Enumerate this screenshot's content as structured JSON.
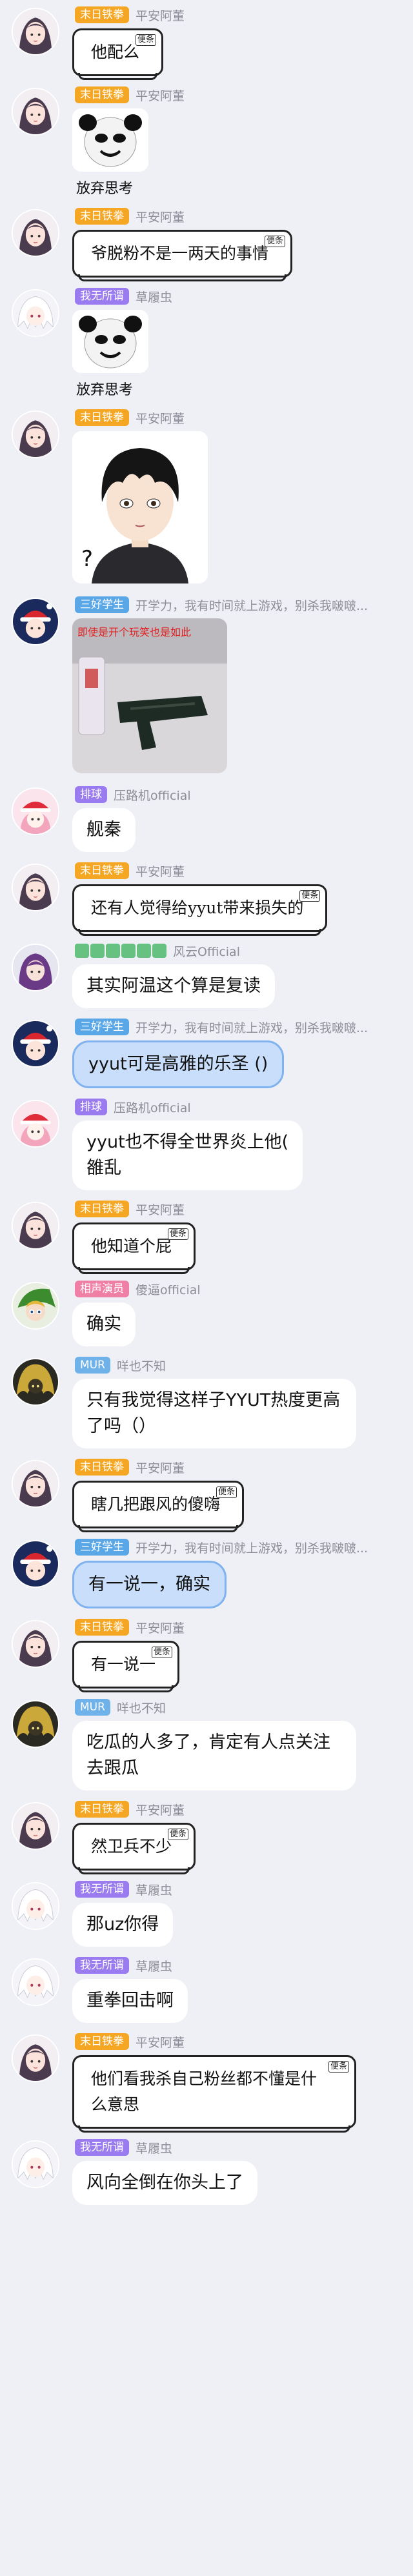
{
  "colors": {
    "badge_orange": "#f5a623",
    "badge_purple": "#9b7cf0",
    "badge_blue": "#5aa7e8",
    "badge_lightblue": "#6fb1e9",
    "badge_pink": "#f07fa6"
  },
  "messages": [
    {
      "badge": "末日铁拳",
      "badge_color": "#f5a623",
      "name": "平安阿董",
      "avatar": "girl-avatar",
      "type": "scroll",
      "text": "他配么",
      "tag": "便条"
    },
    {
      "badge": "末日铁拳",
      "badge_color": "#f5a623",
      "name": "平安阿董",
      "avatar": "girl-avatar",
      "type": "sticker",
      "caption": "放弃思考",
      "sticker": "panda-face-sticker"
    },
    {
      "badge": "末日铁拳",
      "badge_color": "#f5a623",
      "name": "平安阿董",
      "avatar": "girl-avatar",
      "type": "scroll",
      "text": "爷脱粉不是一两天的事情",
      "tag": "便条"
    },
    {
      "badge": "我无所谓",
      "badge_color": "#9b7cf0",
      "name": "草履虫",
      "avatar": "white-hair-avatar",
      "type": "sticker",
      "caption": "放弃思考",
      "sticker": "panda-face-sticker"
    },
    {
      "badge": "末日铁拳",
      "badge_color": "#f5a623",
      "name": "平安阿董",
      "avatar": "girl-avatar",
      "type": "anime",
      "question": "?"
    },
    {
      "badge": "三好学生",
      "badge_color": "#5aa7e8",
      "name": "开学力，我有时间就上游戏，别杀我啵啵...",
      "avatar": "santa-avatar",
      "type": "photo",
      "overlay": "即使是开个玩笑也是如此"
    },
    {
      "badge": "排球",
      "badge_color": "#9b7cf0",
      "name": "压路机official",
      "avatar": "pink-avatar",
      "type": "text",
      "text": "舰秦"
    },
    {
      "badge": "末日铁拳",
      "badge_color": "#f5a623",
      "name": "平安阿董",
      "avatar": "girl-avatar",
      "type": "scroll",
      "text": "还有人觉得给yyut带来损失的",
      "tag": "便条"
    },
    {
      "badge": "",
      "badge_color": "#67c281",
      "name": "风云Official",
      "avatar": "purple-avatar",
      "type": "text",
      "text": "其实阿温这个算是复读",
      "group_badge": true
    },
    {
      "badge": "三好学生",
      "badge_color": "#5aa7e8",
      "name": "开学力，我有时间就上游戏，别杀我啵啵...",
      "avatar": "santa-avatar",
      "type": "cloud",
      "text": "yyut可是高雅的乐圣 ()"
    },
    {
      "badge": "排球",
      "badge_color": "#9b7cf0",
      "name": "压路机official",
      "avatar": "pink-avatar",
      "type": "text",
      "text": "yyut也不得全世界炎上他(\n雒乱"
    },
    {
      "badge": "末日铁拳",
      "badge_color": "#f5a623",
      "name": "平安阿董",
      "avatar": "girl-avatar",
      "type": "scroll",
      "text": "他知道个屁",
      "tag": "便条"
    },
    {
      "badge": "相声演员",
      "badge_color": "#f07fa6",
      "name": "傻逼official",
      "avatar": "link-avatar",
      "type": "text",
      "text": "确实"
    },
    {
      "badge": "MUR",
      "badge_color": "#6fb1e9",
      "name": "咩也不知",
      "avatar": "dark-avatar",
      "type": "text",
      "text": "只有我觉得这样子YYUT热度更高了吗（）"
    },
    {
      "badge": "末日铁拳",
      "badge_color": "#f5a623",
      "name": "平安阿董",
      "avatar": "girl-avatar",
      "type": "scroll",
      "text": "瞎几把跟风的傻嗨",
      "tag": "便条"
    },
    {
      "badge": "三好学生",
      "badge_color": "#5aa7e8",
      "name": "开学力，我有时间就上游戏，别杀我啵啵...",
      "avatar": "santa-avatar",
      "type": "cloud",
      "text": "有一说一，确实"
    },
    {
      "badge": "末日铁拳",
      "badge_color": "#f5a623",
      "name": "平安阿董",
      "avatar": "girl-avatar",
      "type": "scroll",
      "text": "有一说一",
      "tag": "便条"
    },
    {
      "badge": "MUR",
      "badge_color": "#6fb1e9",
      "name": "咩也不知",
      "avatar": "dark-avatar",
      "type": "text",
      "text": "吃瓜的人多了，肯定有人点关注去跟瓜"
    },
    {
      "badge": "末日铁拳",
      "badge_color": "#f5a623",
      "name": "平安阿董",
      "avatar": "girl-avatar",
      "type": "scroll",
      "text": "然卫兵不少",
      "tag": "便条"
    },
    {
      "badge": "我无所谓",
      "badge_color": "#9b7cf0",
      "name": "草履虫",
      "avatar": "white-hair-avatar",
      "type": "text",
      "text": "那uz你得"
    },
    {
      "badge": "我无所谓",
      "badge_color": "#9b7cf0",
      "name": "草履虫",
      "avatar": "white-hair-avatar",
      "type": "text",
      "text": "重拳回击啊"
    },
    {
      "badge": "末日铁拳",
      "badge_color": "#f5a623",
      "name": "平安阿董",
      "avatar": "girl-avatar",
      "type": "scroll",
      "text": "他们看我杀自己粉丝都不懂是什么意思",
      "tag": "便条"
    },
    {
      "badge": "我无所谓",
      "badge_color": "#9b7cf0",
      "name": "草履虫",
      "avatar": "white-hair-avatar",
      "type": "text",
      "text": "风向全倒在你头上了"
    }
  ]
}
